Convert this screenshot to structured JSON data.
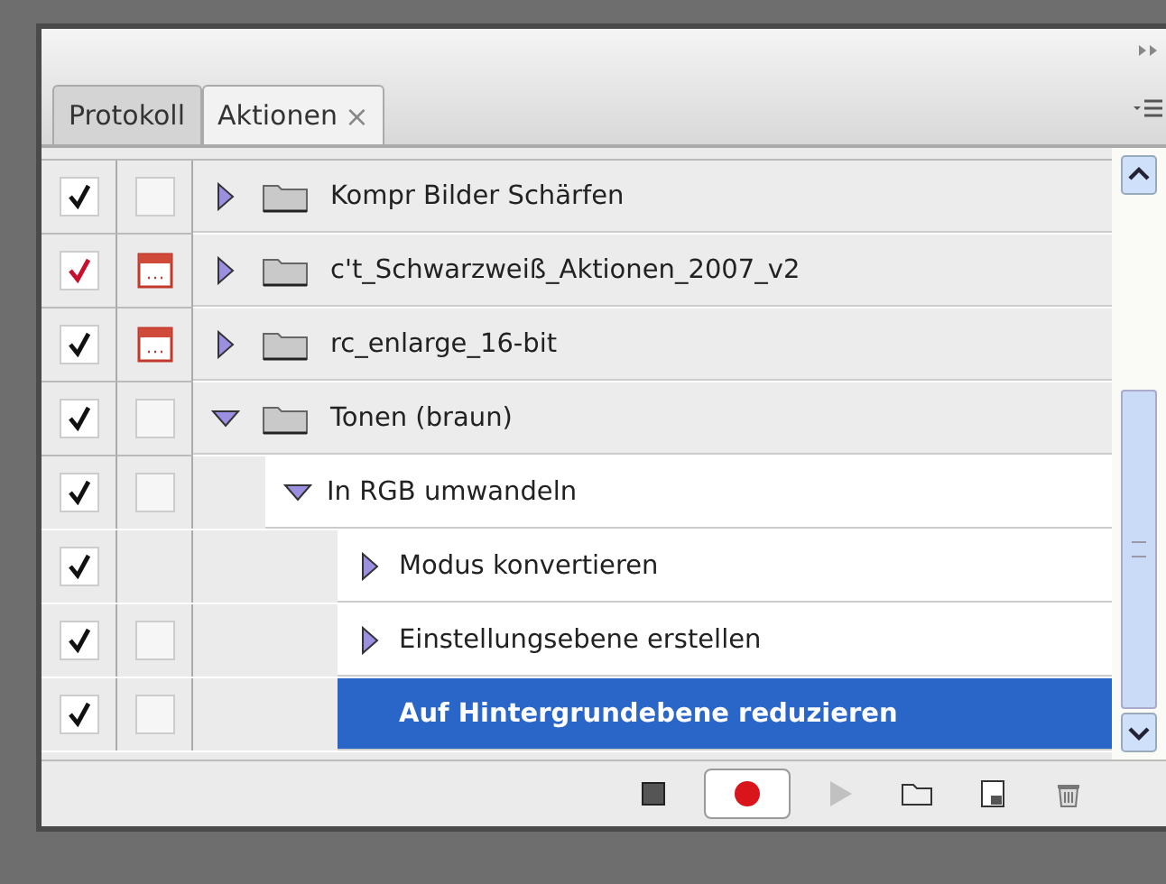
{
  "tabs": [
    {
      "label": "Protokoll",
      "selected": false
    },
    {
      "label": "Aktionen",
      "selected": true,
      "close": "×"
    }
  ],
  "actions": [
    {
      "kind": "set",
      "label": "Kompr Bilder Schärfen",
      "checked": true,
      "color": "#111111",
      "dialog": false,
      "expanded": false,
      "selected": false
    },
    {
      "kind": "set",
      "label": "c't_Schwarzweiß_Aktionen_2007_v2",
      "checked": true,
      "color": "#c8102e",
      "dialog": true,
      "expanded": false,
      "selected": false
    },
    {
      "kind": "set",
      "label": "rc_enlarge_16-bit",
      "checked": true,
      "color": "#111111",
      "dialog": true,
      "expanded": false,
      "selected": false
    },
    {
      "kind": "set",
      "label": "Tonen (braun)",
      "checked": true,
      "color": "#111111",
      "dialog": false,
      "expanded": true,
      "selected": false,
      "children": [
        {
          "kind": "action",
          "label": "In RGB umwandeln",
          "checked": true,
          "color": "#111111",
          "dialog": false,
          "expanded": true,
          "selected": false,
          "children": [
            {
              "kind": "step",
              "label": "Modus konvertieren",
              "checked": true,
              "color": "#111111",
              "expanded": false,
              "selected": false
            },
            {
              "kind": "step",
              "label": "Einstellungsebene erstellen",
              "checked": true,
              "color": "#111111",
              "dialog": false,
              "expanded": false,
              "selected": false
            },
            {
              "kind": "step",
              "label": "Auf Hintergrundebene reduzieren",
              "checked": true,
              "color": "#111111",
              "dialog": false,
              "selected": true
            }
          ]
        }
      ]
    }
  ],
  "toolbar": [
    {
      "kind": "stop",
      "pressed": false,
      "disabled": false
    },
    {
      "kind": "record",
      "pressed": true,
      "disabled": false
    },
    {
      "kind": "play",
      "pressed": false,
      "disabled": true
    },
    {
      "kind": "new-set",
      "pressed": false,
      "disabled": false
    },
    {
      "kind": "new-action",
      "pressed": false,
      "disabled": false
    },
    {
      "kind": "delete",
      "pressed": false,
      "disabled": false
    }
  ]
}
